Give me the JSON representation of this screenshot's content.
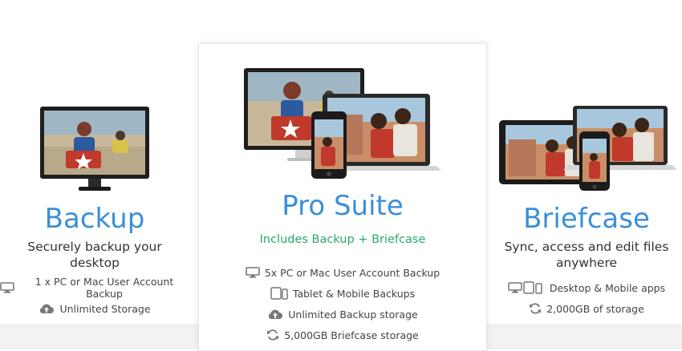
{
  "plans": [
    {
      "title": "Backup",
      "subtitle_line1": "Securely backup your",
      "subtitle_line2": "desktop",
      "features": [
        {
          "icon": "monitor-icon",
          "text": "1 x PC or Mac User Account Backup"
        },
        {
          "icon": "cloud-upload-icon",
          "text": "Unlimited Storage"
        }
      ]
    },
    {
      "title": "Pro Suite",
      "includes": "Includes Backup + Briefcase",
      "features": [
        {
          "icon": "monitor-icon",
          "text": "5x PC or Mac User Account Backup"
        },
        {
          "icon": "tablet-phone-icon",
          "text": "Tablet & Mobile Backups"
        },
        {
          "icon": "cloud-upload-icon",
          "text": "Unlimited Backup storage"
        },
        {
          "icon": "sync-icon",
          "text": "5,000GB Briefcase storage"
        }
      ]
    },
    {
      "title": "Briefcase",
      "subtitle_line1": "Sync, access and edit files",
      "subtitle_line2": "anywhere",
      "features": [
        {
          "icon": "devices-icon",
          "text": "Desktop & Mobile apps"
        },
        {
          "icon": "sync-icon",
          "text": "2,000GB of storage"
        }
      ]
    }
  ],
  "colors": {
    "title_blue": "#3b8fd8",
    "includes_green": "#2aa96b",
    "icon_gray": "#777777"
  }
}
